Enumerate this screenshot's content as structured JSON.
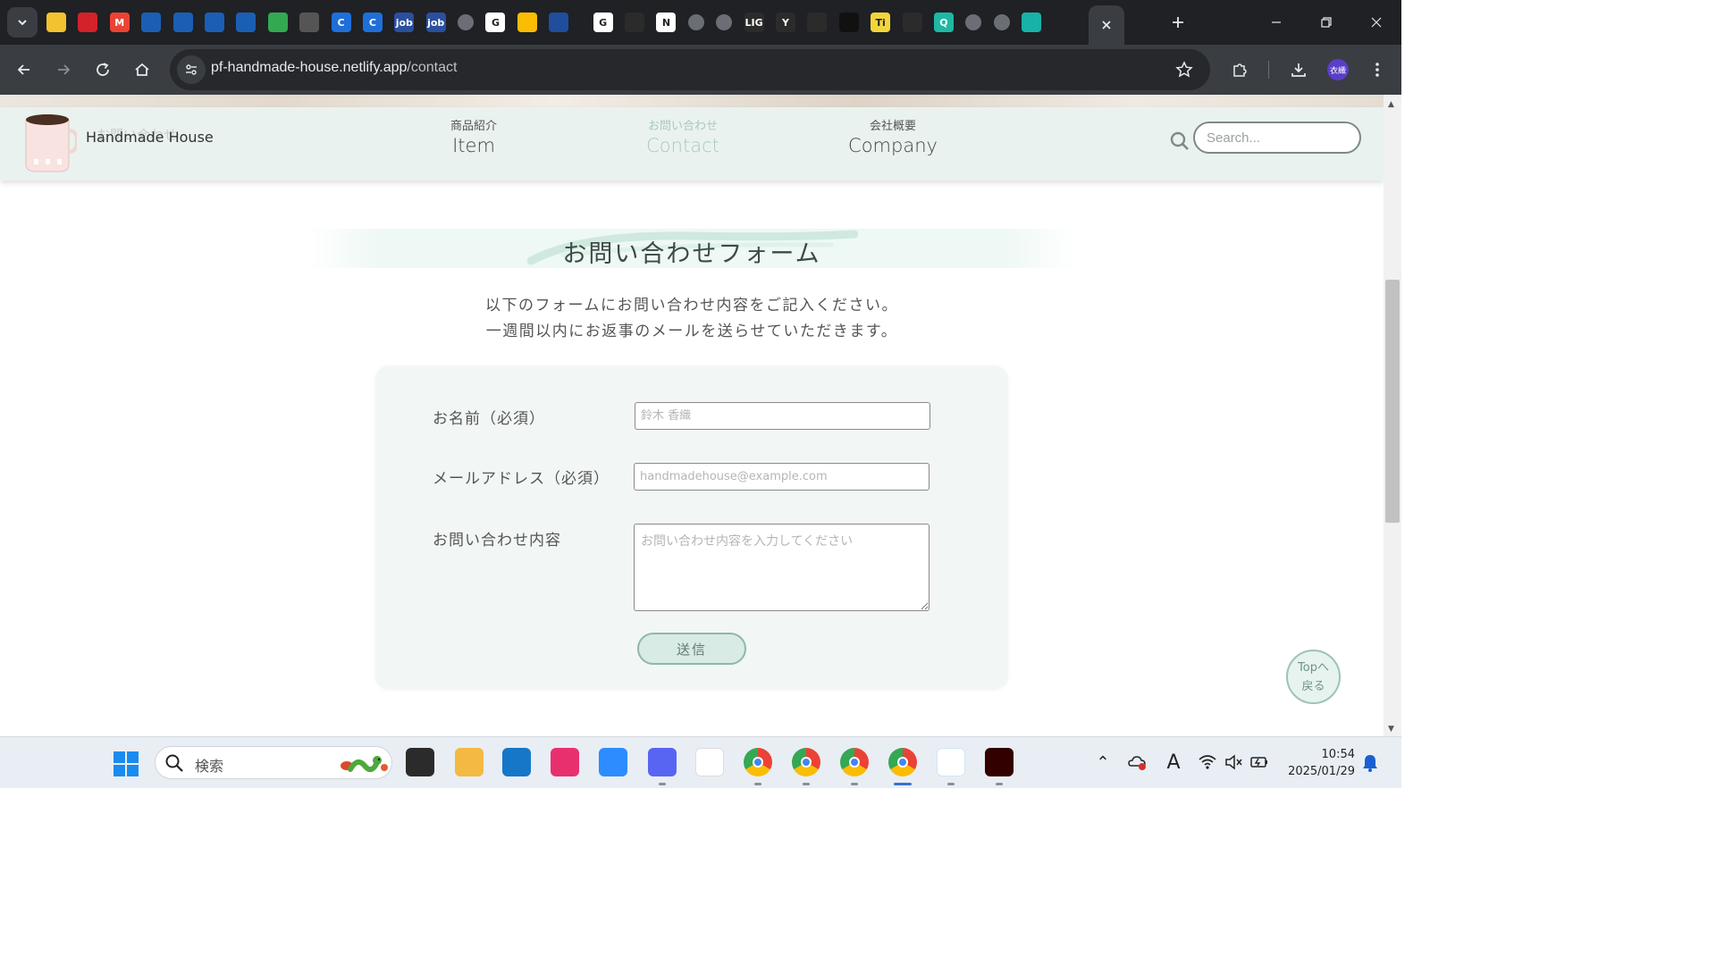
{
  "browser": {
    "url_host": "pf-handmade-house.netlify.app",
    "url_path": "/contact",
    "tab_favicons": [
      {
        "name": "emoji-tab-icon",
        "glyph": "",
        "color": "#f2c230"
      },
      {
        "name": "red-stripes-tab-icon",
        "glyph": "",
        "color": "#d3222a"
      },
      {
        "name": "gmail-tab-icon",
        "glyph": "M",
        "color": "#ea4335"
      },
      {
        "name": "blue-app-tab-icon",
        "glyph": "",
        "color": "#1a5fb4"
      },
      {
        "name": "blue-app-tab-icon",
        "glyph": "",
        "color": "#1a5fb4"
      },
      {
        "name": "blue-app-tab-icon",
        "glyph": "",
        "color": "#1a5fb4"
      },
      {
        "name": "blue-app-tab-icon",
        "glyph": "",
        "color": "#1a5fb4"
      },
      {
        "name": "google-chat-tab-icon",
        "glyph": "",
        "color": "#34a853"
      },
      {
        "name": "tree-tab-icon",
        "glyph": "",
        "color": "#555555"
      },
      {
        "name": "blue-c-tab-icon",
        "glyph": "C",
        "color": "#1e6fd9"
      },
      {
        "name": "blue-c-tab-icon",
        "glyph": "C",
        "color": "#1e6fd9"
      },
      {
        "name": "job-pass-tab-icon",
        "glyph": "job",
        "color": "#2a4f9e"
      },
      {
        "name": "job-pass-tab-icon",
        "glyph": "job",
        "color": "#2a4f9e"
      },
      {
        "name": "globe-tab-icon",
        "glyph": "",
        "color": "#6b6f75"
      },
      {
        "name": "google-tab-icon",
        "glyph": "G",
        "color": "#ffffff"
      },
      {
        "name": "google-drive-tab-icon",
        "glyph": "",
        "color": "#fbbc04"
      },
      {
        "name": "library-tab-icon",
        "glyph": "",
        "color": "#1f4e9c"
      },
      {
        "name": "google-tab-icon",
        "glyph": "G",
        "color": "#ffffff"
      },
      {
        "name": "vscode-tab-icon",
        "glyph": "",
        "color": "#2b2b2b"
      },
      {
        "name": "notion-tab-icon",
        "glyph": "N",
        "color": "#ffffff"
      },
      {
        "name": "globe-tab-icon",
        "glyph": "",
        "color": "#6b6f75"
      },
      {
        "name": "globe-tab-icon",
        "glyph": "",
        "color": "#6b6f75"
      },
      {
        "name": "lig-tab-icon",
        "glyph": "LIG",
        "color": "#2b2b2b"
      },
      {
        "name": "y-tab-icon",
        "glyph": "Y",
        "color": "#2b2b2b"
      },
      {
        "name": "feather-tab-icon",
        "glyph": "",
        "color": "#2b2b2b"
      },
      {
        "name": "dark-circle-tab-icon",
        "glyph": "",
        "color": "#111111"
      },
      {
        "name": "ti-tab-icon",
        "glyph": "Ti",
        "color": "#f2d53c"
      },
      {
        "name": "github-tab-icon",
        "glyph": "",
        "color": "#2b2b2b"
      },
      {
        "name": "q-tab-icon",
        "glyph": "Q",
        "color": "#1fb8a4"
      },
      {
        "name": "globe-tab-icon",
        "glyph": "",
        "color": "#6b6f75"
      },
      {
        "name": "globe-tab-icon",
        "glyph": "",
        "color": "#6b6f75"
      },
      {
        "name": "teal-diamond-tab-icon",
        "glyph": "",
        "color": "#17b3a8"
      }
    ],
    "profile_initials": "衣織"
  },
  "site": {
    "logo_ghost_text": "お問い合わせ",
    "logo_text": "Handmade House",
    "nav": [
      {
        "jp": "商品紹介",
        "en": "Item",
        "active": false
      },
      {
        "jp": "お問い合わせ",
        "en": "Contact",
        "active": true
      },
      {
        "jp": "会社概要",
        "en": "Company",
        "active": false
      }
    ],
    "search_placeholder": "Search..."
  },
  "contact": {
    "title": "お問い合わせフォーム",
    "intro_line1": "以下のフォームにお問い合わせ内容をご記入ください。",
    "intro_line2": "一週間以内にお返事のメールを送らせていただきます。",
    "name_label": "お名前（必須）",
    "name_placeholder": "鈴木 香織",
    "email_label": "メールアドレス（必須）",
    "email_placeholder": "handmadehouse@example.com",
    "message_label": "お問い合わせ内容",
    "message_placeholder": "お問い合わせ内容を入力してください",
    "submit_label": "送信",
    "to_top_line1": "Topへ",
    "to_top_line2": "戻る"
  },
  "taskbar": {
    "search_text": "検索",
    "time": "10:54",
    "date": "2025/01/29",
    "apps": [
      {
        "name": "task-view-icon",
        "color": "#2b2b2b"
      },
      {
        "name": "file-explorer-icon",
        "color": "#f4b942"
      },
      {
        "name": "edge-icon",
        "color": "#1677c9"
      },
      {
        "name": "creative-cloud-icon",
        "color": "#e8306f"
      },
      {
        "name": "zoom-icon",
        "color": "#2d8cff"
      },
      {
        "name": "discord-icon",
        "color": "#5865f2"
      },
      {
        "name": "slack-icon",
        "color": "#ffffff"
      },
      {
        "name": "chrome-icon",
        "color": "#ffffff"
      },
      {
        "name": "chrome-icon",
        "color": "#ffffff"
      },
      {
        "name": "chrome-icon",
        "color": "#ffffff"
      },
      {
        "name": "chrome-icon",
        "color": "#ffffff"
      },
      {
        "name": "vscode-icon",
        "color": "#ffffff"
      },
      {
        "name": "illustrator-icon",
        "color": "#330000"
      }
    ]
  },
  "colors": {
    "header_bg": "#eaf2ef",
    "accent_mint": "#a9c9be",
    "card_bg": "#f2f7f5",
    "chrome_dark": "#1f2124"
  }
}
